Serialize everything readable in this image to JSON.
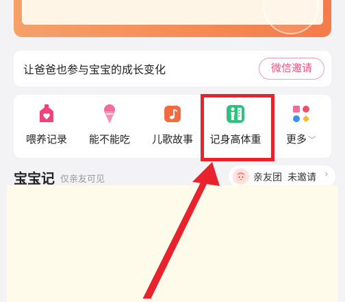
{
  "invite": {
    "text": "让爸爸也参与宝宝的成长变化",
    "button": "微信邀请"
  },
  "tools": [
    {
      "label": "喂养记录",
      "icon": "house-heart-icon"
    },
    {
      "label": "能不能吃",
      "icon": "ice-cream-icon"
    },
    {
      "label": "儿歌故事",
      "icon": "music-note-icon"
    },
    {
      "label": "记身高体重",
      "icon": "height-ruler-icon"
    }
  ],
  "more": {
    "label": "更多",
    "icon": "apps-grid-icon"
  },
  "diary": {
    "title": "宝宝记",
    "subtitle": "仅亲友可见",
    "family_label": "亲友团",
    "family_status": "未邀请"
  },
  "colors": {
    "banner": "#f58a52",
    "accent_pink": "#e9557f",
    "highlight": "#e8232e",
    "content_bg": "#fffbea"
  }
}
